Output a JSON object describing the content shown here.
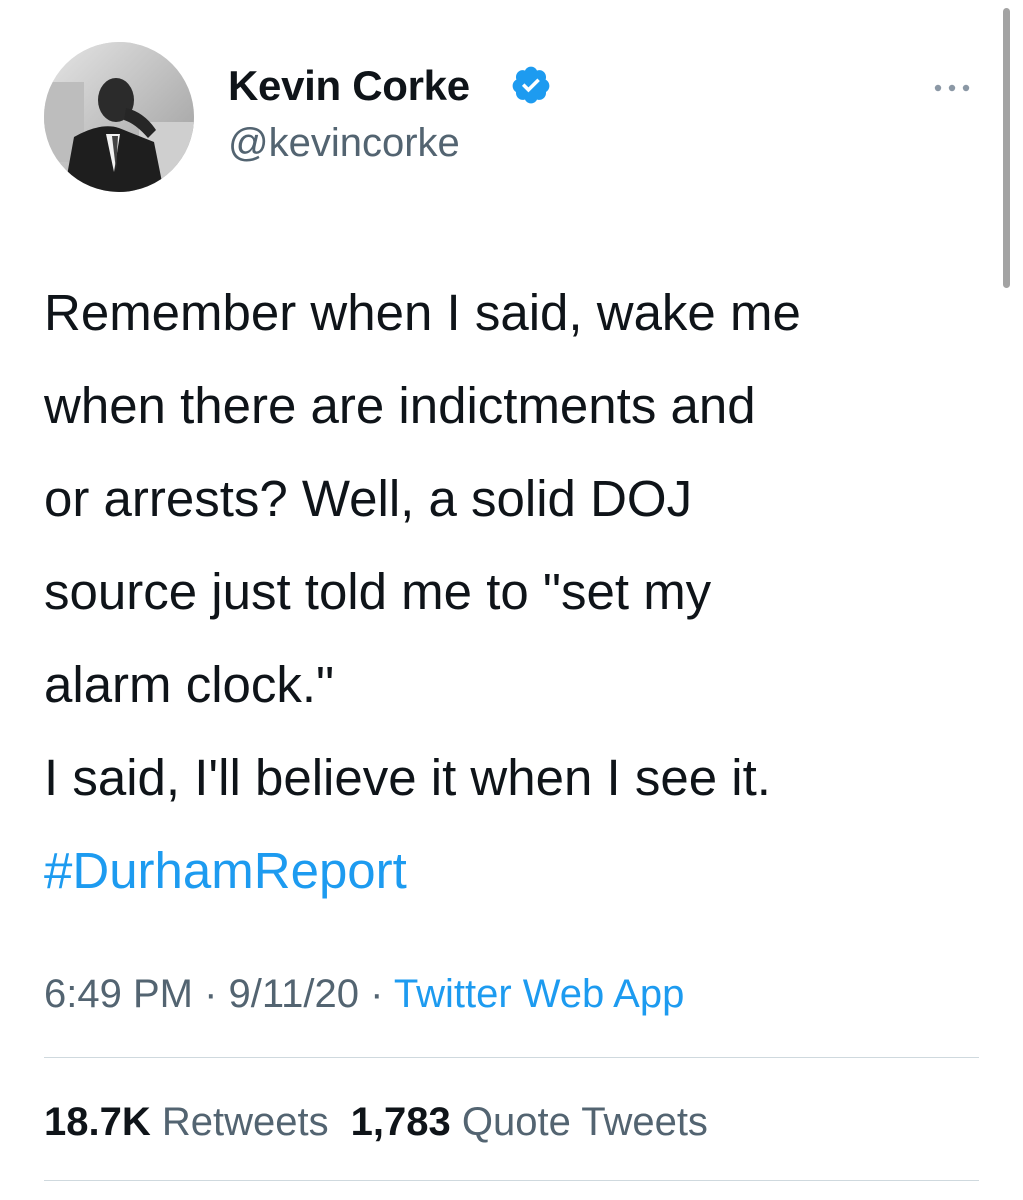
{
  "author": {
    "display_name": "Kevin Corke",
    "handle": "@kevincorke",
    "verified_icon": "verified-badge-icon",
    "avatar_icon": "profile-photo"
  },
  "menu": {
    "icon": "more-options-icon"
  },
  "tweet": {
    "lines": [
      "Remember when I said, wake me",
      "when there are indictments and",
      "or arrests?  Well, a solid DOJ",
      "source just told me to \"set my",
      "alarm clock.\"",
      "I said, I'll believe it when I see it."
    ],
    "hashtag": "#DurhamReport"
  },
  "meta": {
    "time": "6:49 PM",
    "sep1": " · ",
    "date": "9/11/20",
    "sep2": " · ",
    "source": "Twitter Web App"
  },
  "stats": {
    "retweets_count": "18.7K",
    "retweets_label": "Retweets",
    "quotes_count": "1,783",
    "quotes_label": "Quote Tweets"
  },
  "colors": {
    "text": "#0f1419",
    "secondary": "#536471",
    "accent": "#1d9bf0",
    "divider": "#cfd9de"
  }
}
